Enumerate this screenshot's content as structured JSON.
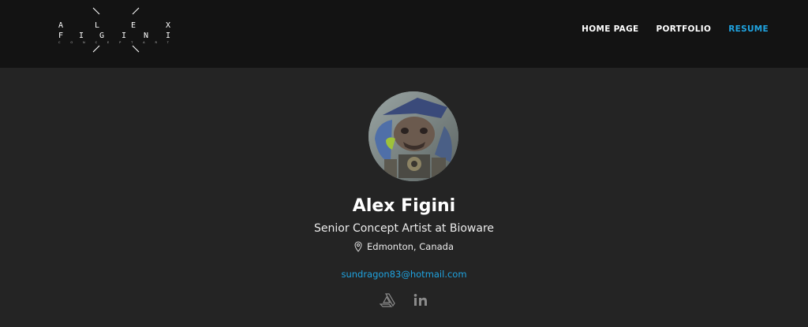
{
  "logo": {
    "row1": [
      "A",
      "L",
      "E",
      "X"
    ],
    "row2": [
      "F",
      "I",
      "G",
      "I",
      "N",
      "I"
    ],
    "row3": "C O N C E P T  A R T",
    "icon": "alex-figini-logo"
  },
  "nav": {
    "items": [
      {
        "label": "HOME PAGE",
        "active": false
      },
      {
        "label": "PORTFOLIO",
        "active": false
      },
      {
        "label": "RESUME",
        "active": true
      }
    ]
  },
  "profile": {
    "avatar_icon": "creature-portrait-avatar",
    "name": "Alex Figini",
    "title": "Senior Concept Artist at Bioware",
    "location": "Edmonton, Canada",
    "location_icon": "map-pin-icon",
    "email": "sundragon83@hotmail.com",
    "social": [
      {
        "icon": "artstation-icon"
      },
      {
        "icon": "linkedin-icon"
      }
    ]
  },
  "colors": {
    "header_bg": "#131313",
    "page_bg": "#242424",
    "accent": "#1fa3e0",
    "text": "#ffffff",
    "icon_gray": "#8a8a8a"
  }
}
